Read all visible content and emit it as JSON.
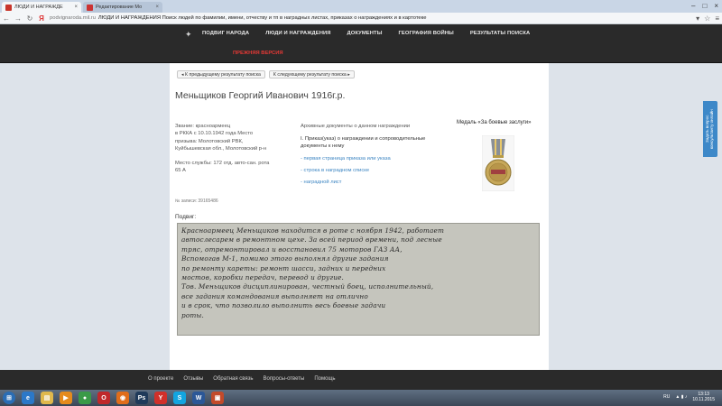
{
  "browser": {
    "tabs": [
      {
        "title": "ЛЮДИ И НАГРАЖДЕ",
        "active": true
      },
      {
        "title": "Редактирование Мо",
        "active": false
      }
    ],
    "url_domain": "podvignaroda.mil.ru",
    "url_title": "ЛЮДИ И НАГРАЖДЕНИЯ Поиск людей по фамилии, имени, отчеству и тп в наградных листах, приказах о награждениях и в картотеке"
  },
  "header": {
    "nav": [
      "ПОДВИГ НАРОДА",
      "ЛЮДИ И НАГРАЖДЕНИЯ",
      "ДОКУМЕНТЫ",
      "ГЕОГРАФИЯ ВОЙНЫ",
      "РЕЗУЛЬТАТЫ ПОИСКА"
    ],
    "old_version": "ПРЕЖНЯЯ ВЕРСИЯ"
  },
  "side_tab": {
    "label": "Задать вопрос консультанту онлайн"
  },
  "pager": {
    "prev": "К предыдущему результату поиска",
    "next": "К следующему результату поиска"
  },
  "person": {
    "name": "Меньщиков Георгий Иванович 1916г.р.",
    "rank_line": "Звание: красноармеец",
    "service_lines": [
      "в РККА с 10.10.1942 года Место",
      "призыва: Молотовский РВК,",
      "Куйбышевская обл., Молотовский р-н"
    ],
    "unit_lines": [
      "Место службы: 172 отд. авто-сан. рота",
      "65 А"
    ],
    "record_no": "№ записи: 39165486"
  },
  "archive": {
    "heading": "Архивные документы о данном награждении",
    "doc_type": "I. Приказ(указ) о награждении и сопроводительные документы к нему",
    "links": [
      "первая страница приказа или указа",
      "строка в наградном списке",
      "наградной лист"
    ]
  },
  "medal": {
    "title": "Медаль «За боевые заслуги»"
  },
  "podvig": {
    "label": "Подвиг:",
    "lines": [
      "Красноармеец Меньщиков находится в роте с ноября 1942, работает",
      "автослесарем в ремонтном цехе. За всей период времени, под лесные",
      "тряс, отремонтировал и восстановил 75 моторов ГАЗ АА,",
      "Вспомогав М-1, помимо этого выполнял другие задания",
      "по ремонту кареты: ремонт шасси, задних и передних",
      "мостов, коробки передач, перевод и другие.",
      "Тов. Меньщиков дисциплинирован, честный боец, исполнительный,",
      "все задания командования выполняет на отлично",
      "и в срок, что позволило выполнить весь боевые задачи",
      "роты."
    ]
  },
  "footer": {
    "links": [
      "О проекте",
      "Отзывы",
      "Обратная связь",
      "Вопросы-ответы",
      "Помощь"
    ]
  },
  "taskbar": {
    "lang": "RU",
    "time": "13:13",
    "date": "10.11.2015"
  },
  "colors": {
    "header_bg": "#2a2a2a",
    "link": "#3c85c2",
    "old_version": "#e53935",
    "side_tab": "#3d88c8"
  }
}
